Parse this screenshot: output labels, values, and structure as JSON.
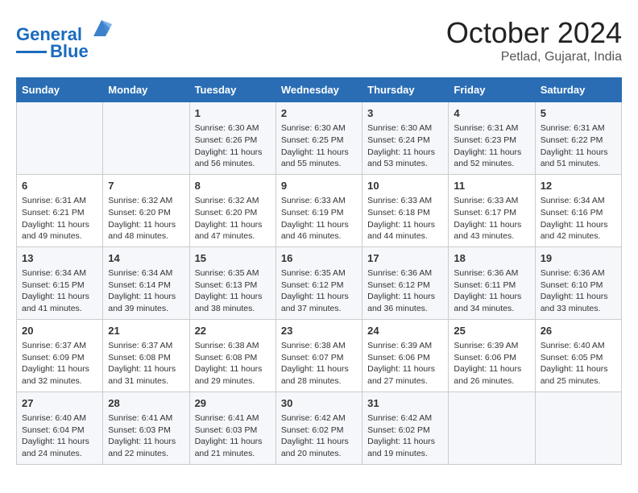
{
  "header": {
    "logo_line1": "General",
    "logo_line2": "Blue",
    "month": "October 2024",
    "location": "Petlad, Gujarat, India"
  },
  "weekdays": [
    "Sunday",
    "Monday",
    "Tuesday",
    "Wednesday",
    "Thursday",
    "Friday",
    "Saturday"
  ],
  "weeks": [
    [
      {
        "day": "",
        "info": ""
      },
      {
        "day": "",
        "info": ""
      },
      {
        "day": "1",
        "info": "Sunrise: 6:30 AM\nSunset: 6:26 PM\nDaylight: 11 hours and 56 minutes."
      },
      {
        "day": "2",
        "info": "Sunrise: 6:30 AM\nSunset: 6:25 PM\nDaylight: 11 hours and 55 minutes."
      },
      {
        "day": "3",
        "info": "Sunrise: 6:30 AM\nSunset: 6:24 PM\nDaylight: 11 hours and 53 minutes."
      },
      {
        "day": "4",
        "info": "Sunrise: 6:31 AM\nSunset: 6:23 PM\nDaylight: 11 hours and 52 minutes."
      },
      {
        "day": "5",
        "info": "Sunrise: 6:31 AM\nSunset: 6:22 PM\nDaylight: 11 hours and 51 minutes."
      }
    ],
    [
      {
        "day": "6",
        "info": "Sunrise: 6:31 AM\nSunset: 6:21 PM\nDaylight: 11 hours and 49 minutes."
      },
      {
        "day": "7",
        "info": "Sunrise: 6:32 AM\nSunset: 6:20 PM\nDaylight: 11 hours and 48 minutes."
      },
      {
        "day": "8",
        "info": "Sunrise: 6:32 AM\nSunset: 6:20 PM\nDaylight: 11 hours and 47 minutes."
      },
      {
        "day": "9",
        "info": "Sunrise: 6:33 AM\nSunset: 6:19 PM\nDaylight: 11 hours and 46 minutes."
      },
      {
        "day": "10",
        "info": "Sunrise: 6:33 AM\nSunset: 6:18 PM\nDaylight: 11 hours and 44 minutes."
      },
      {
        "day": "11",
        "info": "Sunrise: 6:33 AM\nSunset: 6:17 PM\nDaylight: 11 hours and 43 minutes."
      },
      {
        "day": "12",
        "info": "Sunrise: 6:34 AM\nSunset: 6:16 PM\nDaylight: 11 hours and 42 minutes."
      }
    ],
    [
      {
        "day": "13",
        "info": "Sunrise: 6:34 AM\nSunset: 6:15 PM\nDaylight: 11 hours and 41 minutes."
      },
      {
        "day": "14",
        "info": "Sunrise: 6:34 AM\nSunset: 6:14 PM\nDaylight: 11 hours and 39 minutes."
      },
      {
        "day": "15",
        "info": "Sunrise: 6:35 AM\nSunset: 6:13 PM\nDaylight: 11 hours and 38 minutes."
      },
      {
        "day": "16",
        "info": "Sunrise: 6:35 AM\nSunset: 6:12 PM\nDaylight: 11 hours and 37 minutes."
      },
      {
        "day": "17",
        "info": "Sunrise: 6:36 AM\nSunset: 6:12 PM\nDaylight: 11 hours and 36 minutes."
      },
      {
        "day": "18",
        "info": "Sunrise: 6:36 AM\nSunset: 6:11 PM\nDaylight: 11 hours and 34 minutes."
      },
      {
        "day": "19",
        "info": "Sunrise: 6:36 AM\nSunset: 6:10 PM\nDaylight: 11 hours and 33 minutes."
      }
    ],
    [
      {
        "day": "20",
        "info": "Sunrise: 6:37 AM\nSunset: 6:09 PM\nDaylight: 11 hours and 32 minutes."
      },
      {
        "day": "21",
        "info": "Sunrise: 6:37 AM\nSunset: 6:08 PM\nDaylight: 11 hours and 31 minutes."
      },
      {
        "day": "22",
        "info": "Sunrise: 6:38 AM\nSunset: 6:08 PM\nDaylight: 11 hours and 29 minutes."
      },
      {
        "day": "23",
        "info": "Sunrise: 6:38 AM\nSunset: 6:07 PM\nDaylight: 11 hours and 28 minutes."
      },
      {
        "day": "24",
        "info": "Sunrise: 6:39 AM\nSunset: 6:06 PM\nDaylight: 11 hours and 27 minutes."
      },
      {
        "day": "25",
        "info": "Sunrise: 6:39 AM\nSunset: 6:06 PM\nDaylight: 11 hours and 26 minutes."
      },
      {
        "day": "26",
        "info": "Sunrise: 6:40 AM\nSunset: 6:05 PM\nDaylight: 11 hours and 25 minutes."
      }
    ],
    [
      {
        "day": "27",
        "info": "Sunrise: 6:40 AM\nSunset: 6:04 PM\nDaylight: 11 hours and 24 minutes."
      },
      {
        "day": "28",
        "info": "Sunrise: 6:41 AM\nSunset: 6:03 PM\nDaylight: 11 hours and 22 minutes."
      },
      {
        "day": "29",
        "info": "Sunrise: 6:41 AM\nSunset: 6:03 PM\nDaylight: 11 hours and 21 minutes."
      },
      {
        "day": "30",
        "info": "Sunrise: 6:42 AM\nSunset: 6:02 PM\nDaylight: 11 hours and 20 minutes."
      },
      {
        "day": "31",
        "info": "Sunrise: 6:42 AM\nSunset: 6:02 PM\nDaylight: 11 hours and 19 minutes."
      },
      {
        "day": "",
        "info": ""
      },
      {
        "day": "",
        "info": ""
      }
    ]
  ]
}
